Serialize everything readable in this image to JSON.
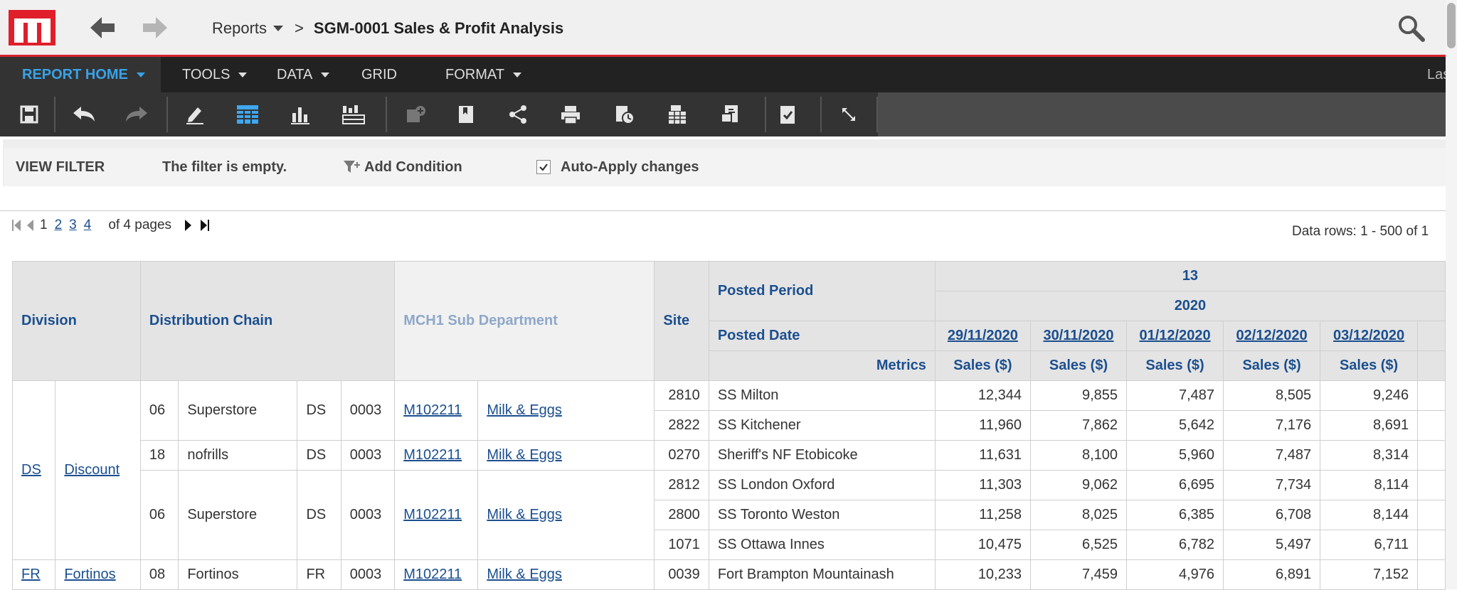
{
  "header": {
    "breadcrumb_root": "Reports",
    "breadcrumb_sep": ">",
    "report_title": "SGM-0001 Sales & Profit Analysis"
  },
  "menu": {
    "items": [
      "REPORT HOME",
      "TOOLS",
      "DATA",
      "GRID",
      "FORMAT"
    ],
    "right_text": "Last"
  },
  "toolbar": {
    "icons": [
      "save-icon",
      "undo-icon",
      "redo-icon",
      "edit-icon",
      "grid-view-icon",
      "graph-view-icon",
      "grid-graph-icon",
      "add-dataset-icon",
      "bookmark-icon",
      "share-icon",
      "print-icon",
      "schedule-icon",
      "export-icon",
      "export-pdf-icon",
      "subscribe-icon",
      "fullscreen-icon"
    ]
  },
  "filter": {
    "label": "VIEW FILTER",
    "empty_text": "The filter is empty.",
    "add_condition": "Add Condition",
    "auto_apply": "Auto-Apply changes",
    "auto_apply_checked": true
  },
  "pager": {
    "pages": [
      "1",
      "2",
      "3",
      "4"
    ],
    "of_text": "of 4 pages",
    "row_info": "Data rows: 1 - 500 of 1"
  },
  "grid": {
    "headers": {
      "division": "Division",
      "distribution_chain": "Distribution Chain",
      "mch1": "MCH1 Sub Department",
      "site": "Site",
      "posted_period": "Posted Period",
      "period_value": "13",
      "year_value": "2020",
      "posted_date": "Posted Date",
      "metrics": "Metrics",
      "dates": [
        "29/11/2020",
        "30/11/2020",
        "01/12/2020",
        "02/12/2020",
        "03/12/2020"
      ],
      "metric_name": "Sales ($)"
    },
    "division_group": {
      "code": "DS",
      "name": "Discount"
    },
    "chains": {
      "superstore_06": {
        "code": "06",
        "name": "Superstore",
        "div": "DS",
        "sub": "0003",
        "mch": "M102211",
        "dept": "Milk & Eggs"
      },
      "nofrills_18": {
        "code": "18",
        "name": "nofrills",
        "div": "DS",
        "sub": "0003",
        "mch": "M102211",
        "dept": "Milk & Eggs"
      },
      "superstore_06b": {
        "code": "06",
        "name": "Superstore",
        "div": "DS",
        "sub": "0003",
        "mch": "M102211",
        "dept": "Milk & Eggs"
      }
    },
    "rows": [
      {
        "site": "2810",
        "name": "SS Milton",
        "values": [
          "12,344",
          "9,855",
          "7,487",
          "8,505",
          "9,246"
        ]
      },
      {
        "site": "2822",
        "name": "SS Kitchener",
        "values": [
          "11,960",
          "7,862",
          "5,642",
          "7,176",
          "8,691"
        ]
      },
      {
        "site": "0270",
        "name": "Sheriff's NF Etobicoke",
        "values": [
          "11,631",
          "8,100",
          "5,960",
          "7,487",
          "8,314"
        ]
      },
      {
        "site": "2812",
        "name": "SS London Oxford",
        "values": [
          "11,303",
          "9,062",
          "6,695",
          "7,734",
          "8,114"
        ]
      },
      {
        "site": "2800",
        "name": "SS Toronto Weston",
        "values": [
          "11,258",
          "8,025",
          "6,385",
          "6,708",
          "8,144"
        ]
      },
      {
        "site": "1071",
        "name": "SS Ottawa Innes",
        "values": [
          "10,475",
          "6,525",
          "6,782",
          "5,497",
          "6,711"
        ]
      }
    ],
    "last_row": {
      "div_code": "FR",
      "div_name": "Fortinos",
      "chain_code": "08",
      "chain_name": "Fortinos",
      "div": "FR",
      "sub": "0003",
      "mch": "M102211",
      "dept": "Milk & Eggs",
      "site": "0039",
      "name": "Fort Brampton Mountainash",
      "values": [
        "10,233",
        "7,459",
        "4,976",
        "6,891",
        "7,152"
      ]
    }
  }
}
